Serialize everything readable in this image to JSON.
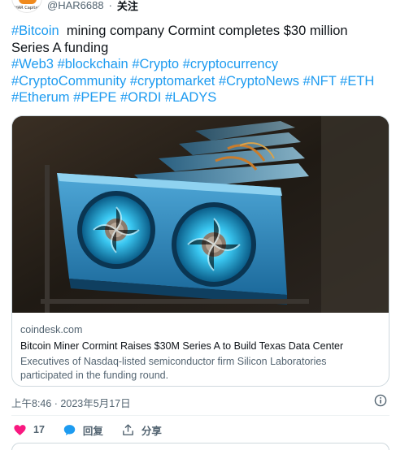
{
  "header": {
    "avatar_text": "HAR Capital",
    "handle": "@HAR6688",
    "separator": "·",
    "follow_label": "关注"
  },
  "tweet": {
    "line1_tag": "#Bitcoin",
    "line1_rest": "  mining company Cormint completes $30 million",
    "line2": "Series A funding",
    "hashtags_line3": [
      "#Web3",
      "#blockchain",
      "#Crypto",
      "#cryptocurrency"
    ],
    "hashtags_line4": [
      "#CryptoCommunity",
      "#cryptomarket",
      "#CryptoNews",
      "#NFT",
      "#ETH"
    ],
    "hashtags_line5": [
      "#Etherum",
      "#PEPE",
      "#ORDI",
      "#LADYS"
    ]
  },
  "card": {
    "image_subject": "GPU graphics cards with blue glowing fans in a mining rig",
    "domain": "coindesk.com",
    "title": "Bitcoin Miner Cormint Raises $30M Series A to Build Texas Data Center",
    "description": "Executives of Nasdaq-listed semiconductor firm Silicon Laboratories participated in the funding round."
  },
  "meta": {
    "timestamp": "上午8:46 · 2023年5月17日"
  },
  "actions": {
    "like_count": "17",
    "reply_label": "回复",
    "share_label": "分享"
  },
  "colors": {
    "accent": "#1d9bf0",
    "like": "#f91880",
    "muted": "#536471",
    "border": "#cfd9de"
  }
}
